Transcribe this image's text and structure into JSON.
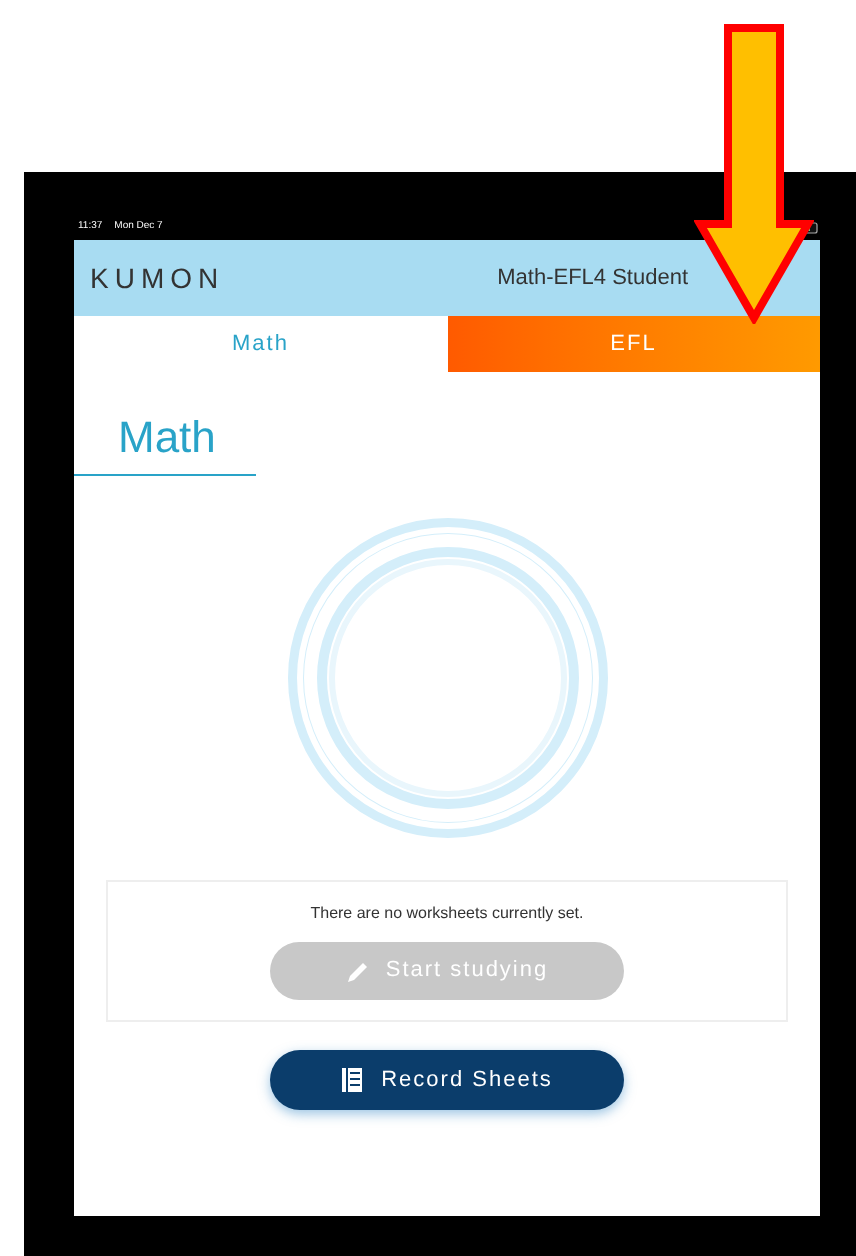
{
  "status_bar": {
    "time": "11:37",
    "date": "Mon Dec 7"
  },
  "header": {
    "logo": "KUMON",
    "student": "Math-EFL4 Student"
  },
  "tabs": [
    {
      "label": "Math",
      "selected": true
    },
    {
      "label": "EFL",
      "selected": false
    }
  ],
  "subject_title": "Math",
  "worksheets": {
    "message": "There are no worksheets currently set.",
    "start_button": {
      "label": "Start studying",
      "disabled": true
    }
  },
  "record_button": {
    "label": "Record Sheets"
  }
}
